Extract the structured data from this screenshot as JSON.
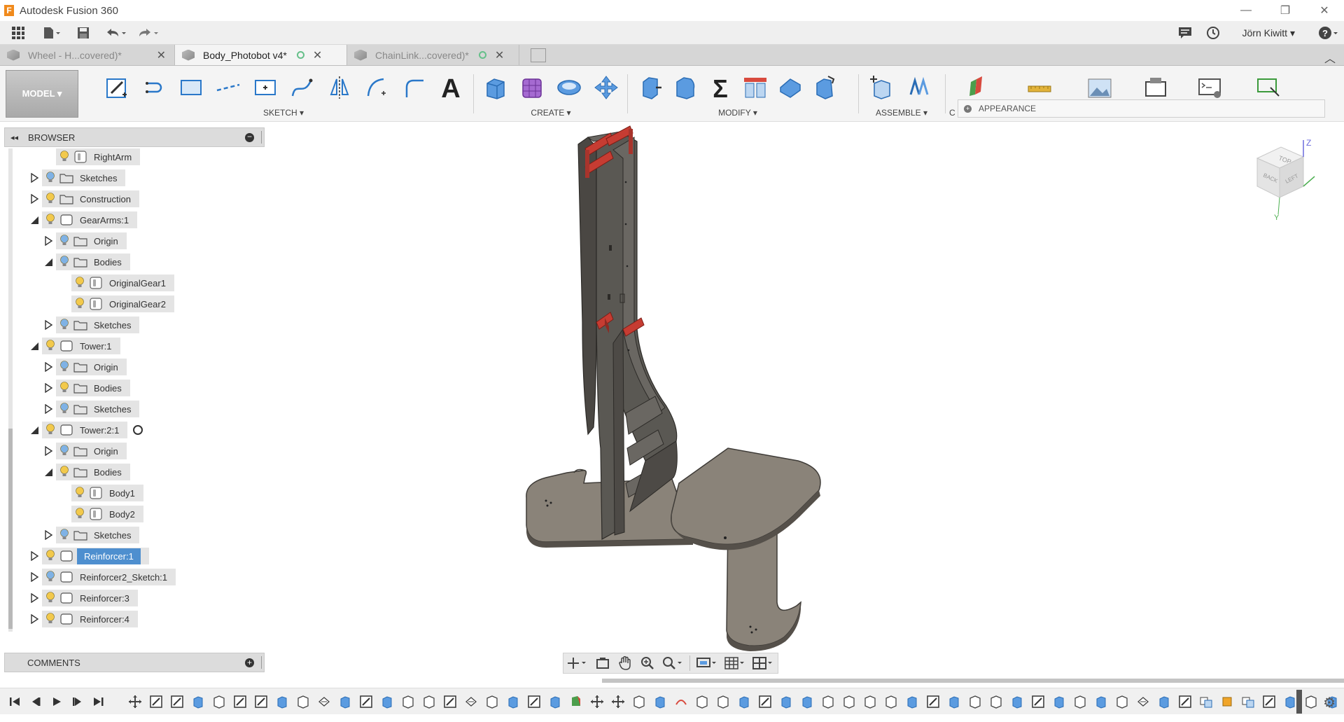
{
  "app": {
    "title": "Autodesk Fusion 360",
    "user": "Jörn Kiwitt"
  },
  "tabs": [
    {
      "label": "Wheel - H...covered)*",
      "active": false,
      "has_dot": false
    },
    {
      "label": "Body_Photobot v4*",
      "active": true,
      "has_dot": true
    },
    {
      "label": "ChainLink...covered)*",
      "active": false,
      "has_dot": true
    }
  ],
  "ribbon": {
    "workspace": "MODEL ▾",
    "groups": [
      "SKETCH ▾",
      "CREATE ▾",
      "MODIFY ▾",
      "ASSEMBLE ▾",
      "C"
    ],
    "appearance_popup": "APPEARANCE"
  },
  "browser": {
    "title": "BROWSER",
    "nodes": [
      {
        "label": "RightArm",
        "level": 2,
        "toggle": "none",
        "kind": "body",
        "bulb": "on"
      },
      {
        "label": "Sketches",
        "level": 1,
        "toggle": "collapsed",
        "kind": "folder",
        "bulb": "off"
      },
      {
        "label": "Construction",
        "level": 1,
        "toggle": "collapsed",
        "kind": "folder",
        "bulb": "on"
      },
      {
        "label": "GearArms:1",
        "level": 1,
        "toggle": "expanded",
        "kind": "component",
        "bulb": "on"
      },
      {
        "label": "Origin",
        "level": 2,
        "toggle": "collapsed",
        "kind": "folder",
        "bulb": "off"
      },
      {
        "label": "Bodies",
        "level": 2,
        "toggle": "expanded",
        "kind": "folder",
        "bulb": "off"
      },
      {
        "label": "OriginalGear1",
        "level": 3,
        "toggle": "none",
        "kind": "body",
        "bulb": "on"
      },
      {
        "label": "OriginalGear2",
        "level": 3,
        "toggle": "none",
        "kind": "body",
        "bulb": "on"
      },
      {
        "label": "Sketches",
        "level": 2,
        "toggle": "collapsed",
        "kind": "folder",
        "bulb": "off"
      },
      {
        "label": "Tower:1",
        "level": 1,
        "toggle": "expanded",
        "kind": "component",
        "bulb": "on"
      },
      {
        "label": "Origin",
        "level": 2,
        "toggle": "collapsed",
        "kind": "folder",
        "bulb": "off"
      },
      {
        "label": "Bodies",
        "level": 2,
        "toggle": "collapsed",
        "kind": "folder",
        "bulb": "on"
      },
      {
        "label": "Sketches",
        "level": 2,
        "toggle": "collapsed",
        "kind": "folder",
        "bulb": "off"
      },
      {
        "label": "Tower:2:1",
        "level": 1,
        "toggle": "expanded",
        "kind": "component",
        "bulb": "on",
        "ring": true
      },
      {
        "label": "Origin",
        "level": 2,
        "toggle": "collapsed",
        "kind": "folder",
        "bulb": "off"
      },
      {
        "label": "Bodies",
        "level": 2,
        "toggle": "expanded",
        "kind": "folder",
        "bulb": "on"
      },
      {
        "label": "Body1",
        "level": 3,
        "toggle": "none",
        "kind": "body",
        "bulb": "on"
      },
      {
        "label": "Body2",
        "level": 3,
        "toggle": "none",
        "kind": "body",
        "bulb": "on"
      },
      {
        "label": "Sketches",
        "level": 2,
        "toggle": "collapsed",
        "kind": "folder",
        "bulb": "off"
      },
      {
        "label": "Reinforcer:1",
        "level": 1,
        "toggle": "collapsed",
        "kind": "component",
        "bulb": "on",
        "selected": true
      },
      {
        "label": "Reinforcer2_Sketch:1",
        "level": 1,
        "toggle": "collapsed",
        "kind": "component",
        "bulb": "off"
      },
      {
        "label": "Reinforcer:3",
        "level": 1,
        "toggle": "collapsed",
        "kind": "component",
        "bulb": "on"
      },
      {
        "label": "Reinforcer:4",
        "level": 1,
        "toggle": "collapsed",
        "kind": "component",
        "bulb": "on"
      }
    ]
  },
  "comments": {
    "title": "COMMENTS"
  },
  "viewcube": {
    "top": "TOP",
    "back": "BACK",
    "left": "LEFT",
    "axis_z": "Z",
    "axis_y": "Y"
  },
  "colors": {
    "bulb_on": "#f2c94c",
    "bulb_off": "#7fb2e5",
    "selection": "#4e8fcf",
    "model_body": "#5a5853",
    "model_plate": "#8a8379",
    "reinforcer_red": "#c63c32"
  }
}
